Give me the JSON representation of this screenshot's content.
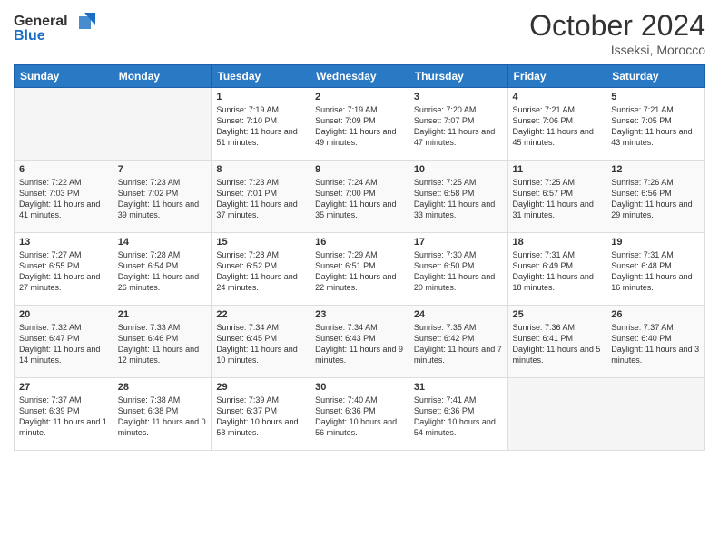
{
  "logo": {
    "line1": "General",
    "line2": "Blue"
  },
  "title": "October 2024",
  "subtitle": "Isseksi, Morocco",
  "days_header": [
    "Sunday",
    "Monday",
    "Tuesday",
    "Wednesday",
    "Thursday",
    "Friday",
    "Saturday"
  ],
  "weeks": [
    {
      "cells": [
        {
          "day": "",
          "info": ""
        },
        {
          "day": "",
          "info": ""
        },
        {
          "day": "1",
          "info": "Sunrise: 7:19 AM\nSunset: 7:10 PM\nDaylight: 11 hours and 51 minutes."
        },
        {
          "day": "2",
          "info": "Sunrise: 7:19 AM\nSunset: 7:09 PM\nDaylight: 11 hours and 49 minutes."
        },
        {
          "day": "3",
          "info": "Sunrise: 7:20 AM\nSunset: 7:07 PM\nDaylight: 11 hours and 47 minutes."
        },
        {
          "day": "4",
          "info": "Sunrise: 7:21 AM\nSunset: 7:06 PM\nDaylight: 11 hours and 45 minutes."
        },
        {
          "day": "5",
          "info": "Sunrise: 7:21 AM\nSunset: 7:05 PM\nDaylight: 11 hours and 43 minutes."
        }
      ]
    },
    {
      "cells": [
        {
          "day": "6",
          "info": "Sunrise: 7:22 AM\nSunset: 7:03 PM\nDaylight: 11 hours and 41 minutes."
        },
        {
          "day": "7",
          "info": "Sunrise: 7:23 AM\nSunset: 7:02 PM\nDaylight: 11 hours and 39 minutes."
        },
        {
          "day": "8",
          "info": "Sunrise: 7:23 AM\nSunset: 7:01 PM\nDaylight: 11 hours and 37 minutes."
        },
        {
          "day": "9",
          "info": "Sunrise: 7:24 AM\nSunset: 7:00 PM\nDaylight: 11 hours and 35 minutes."
        },
        {
          "day": "10",
          "info": "Sunrise: 7:25 AM\nSunset: 6:58 PM\nDaylight: 11 hours and 33 minutes."
        },
        {
          "day": "11",
          "info": "Sunrise: 7:25 AM\nSunset: 6:57 PM\nDaylight: 11 hours and 31 minutes."
        },
        {
          "day": "12",
          "info": "Sunrise: 7:26 AM\nSunset: 6:56 PM\nDaylight: 11 hours and 29 minutes."
        }
      ]
    },
    {
      "cells": [
        {
          "day": "13",
          "info": "Sunrise: 7:27 AM\nSunset: 6:55 PM\nDaylight: 11 hours and 27 minutes."
        },
        {
          "day": "14",
          "info": "Sunrise: 7:28 AM\nSunset: 6:54 PM\nDaylight: 11 hours and 26 minutes."
        },
        {
          "day": "15",
          "info": "Sunrise: 7:28 AM\nSunset: 6:52 PM\nDaylight: 11 hours and 24 minutes."
        },
        {
          "day": "16",
          "info": "Sunrise: 7:29 AM\nSunset: 6:51 PM\nDaylight: 11 hours and 22 minutes."
        },
        {
          "day": "17",
          "info": "Sunrise: 7:30 AM\nSunset: 6:50 PM\nDaylight: 11 hours and 20 minutes."
        },
        {
          "day": "18",
          "info": "Sunrise: 7:31 AM\nSunset: 6:49 PM\nDaylight: 11 hours and 18 minutes."
        },
        {
          "day": "19",
          "info": "Sunrise: 7:31 AM\nSunset: 6:48 PM\nDaylight: 11 hours and 16 minutes."
        }
      ]
    },
    {
      "cells": [
        {
          "day": "20",
          "info": "Sunrise: 7:32 AM\nSunset: 6:47 PM\nDaylight: 11 hours and 14 minutes."
        },
        {
          "day": "21",
          "info": "Sunrise: 7:33 AM\nSunset: 6:46 PM\nDaylight: 11 hours and 12 minutes."
        },
        {
          "day": "22",
          "info": "Sunrise: 7:34 AM\nSunset: 6:45 PM\nDaylight: 11 hours and 10 minutes."
        },
        {
          "day": "23",
          "info": "Sunrise: 7:34 AM\nSunset: 6:43 PM\nDaylight: 11 hours and 9 minutes."
        },
        {
          "day": "24",
          "info": "Sunrise: 7:35 AM\nSunset: 6:42 PM\nDaylight: 11 hours and 7 minutes."
        },
        {
          "day": "25",
          "info": "Sunrise: 7:36 AM\nSunset: 6:41 PM\nDaylight: 11 hours and 5 minutes."
        },
        {
          "day": "26",
          "info": "Sunrise: 7:37 AM\nSunset: 6:40 PM\nDaylight: 11 hours and 3 minutes."
        }
      ]
    },
    {
      "cells": [
        {
          "day": "27",
          "info": "Sunrise: 7:37 AM\nSunset: 6:39 PM\nDaylight: 11 hours and 1 minute."
        },
        {
          "day": "28",
          "info": "Sunrise: 7:38 AM\nSunset: 6:38 PM\nDaylight: 11 hours and 0 minutes."
        },
        {
          "day": "29",
          "info": "Sunrise: 7:39 AM\nSunset: 6:37 PM\nDaylight: 10 hours and 58 minutes."
        },
        {
          "day": "30",
          "info": "Sunrise: 7:40 AM\nSunset: 6:36 PM\nDaylight: 10 hours and 56 minutes."
        },
        {
          "day": "31",
          "info": "Sunrise: 7:41 AM\nSunset: 6:36 PM\nDaylight: 10 hours and 54 minutes."
        },
        {
          "day": "",
          "info": ""
        },
        {
          "day": "",
          "info": ""
        }
      ]
    }
  ]
}
